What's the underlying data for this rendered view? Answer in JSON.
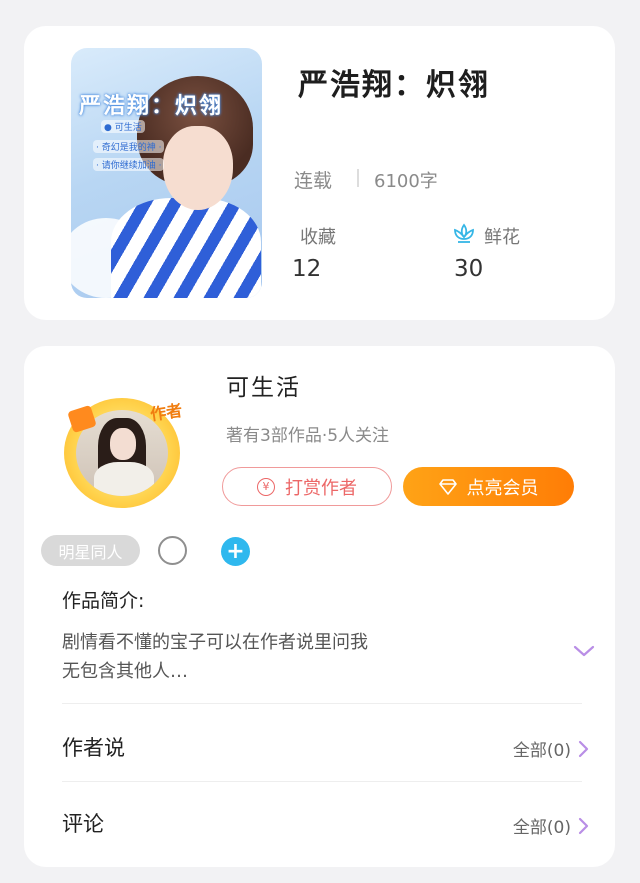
{
  "book": {
    "cover_title": "严浩翔：炽翎",
    "cover_lines": [
      "● 可生活",
      "· 奇幻是我的神 ·",
      "· 请你继续加油 ·"
    ],
    "title": "严浩翔：炽翎",
    "status": "连载",
    "word_count": "6100字",
    "favorites_label": "收藏",
    "favorites_value": "12",
    "flowers_label": "鲜花",
    "flowers_value": "30"
  },
  "author": {
    "avatar_tag": "作者",
    "name": "可生活",
    "meta": "著有3部作品·5人关注",
    "reward_label": "打赏作者",
    "vip_label": "点亮会员",
    "yen_symbol": "¥",
    "tag_chip": "明星同人",
    "add_symbol": "+"
  },
  "intro": {
    "title": "作品简介:",
    "lines": [
      "剧情看不懂的宝子可以在作者说里问我",
      "无包含其他人…"
    ]
  },
  "rows": [
    {
      "title": "作者说",
      "more": "全部(0)"
    },
    {
      "title": "评论",
      "more": "全部(0)"
    }
  ],
  "colors": {
    "accent_orange": "#ff8c0a",
    "reward_red": "#ec6767",
    "add_blue": "#2fb8ee",
    "chevron_purple": "#b98ee6"
  }
}
